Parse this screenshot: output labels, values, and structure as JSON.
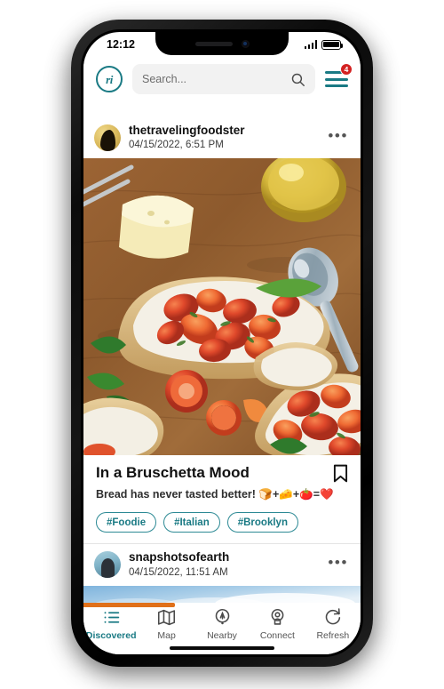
{
  "status_bar": {
    "time": "12:12",
    "signal_icon": "cellular-signal-icon",
    "battery_icon": "battery-full-icon"
  },
  "header": {
    "logo_text": "ri",
    "logo_name": "app-logo-icon",
    "search": {
      "placeholder": "Search...",
      "value": "",
      "icon": "search-icon"
    },
    "menu": {
      "icon": "hamburger-menu-icon",
      "badge_count": "4"
    }
  },
  "feed": {
    "posts": [
      {
        "username": "thetravelingfoodster",
        "timestamp": "04/15/2022, 6:51 PM",
        "more_label": "•••",
        "avatar_name": "avatar-thetravelingfoodster",
        "photo_alt": "bruschetta-photo",
        "title": "In a Bruschetta Mood",
        "description": "Bread has never tasted better! 🍞+🧀+🍅=❤️",
        "bookmark_icon": "bookmark-icon",
        "tags": [
          "#Foodie",
          "#Italian",
          "#Brooklyn"
        ]
      },
      {
        "username": "snapshotsofearth",
        "timestamp": "04/15/2022, 11:51 AM",
        "more_label": "•••",
        "avatar_name": "avatar-snapshotsofearth",
        "photo_alt": "sky-clouds-photo"
      }
    ]
  },
  "tab_bar": {
    "progress_percent": 33,
    "progress_color": "#e0701a",
    "accent_color": "#1a7a84",
    "items": [
      {
        "label": "Discovered",
        "icon": "list-icon",
        "active": true
      },
      {
        "label": "Map",
        "icon": "map-icon",
        "active": false
      },
      {
        "label": "Nearby",
        "icon": "nearby-pin-icon",
        "active": false
      },
      {
        "label": "Connect",
        "icon": "connect-person-icon",
        "active": false
      },
      {
        "label": "Refresh",
        "icon": "refresh-icon",
        "active": false
      }
    ]
  }
}
